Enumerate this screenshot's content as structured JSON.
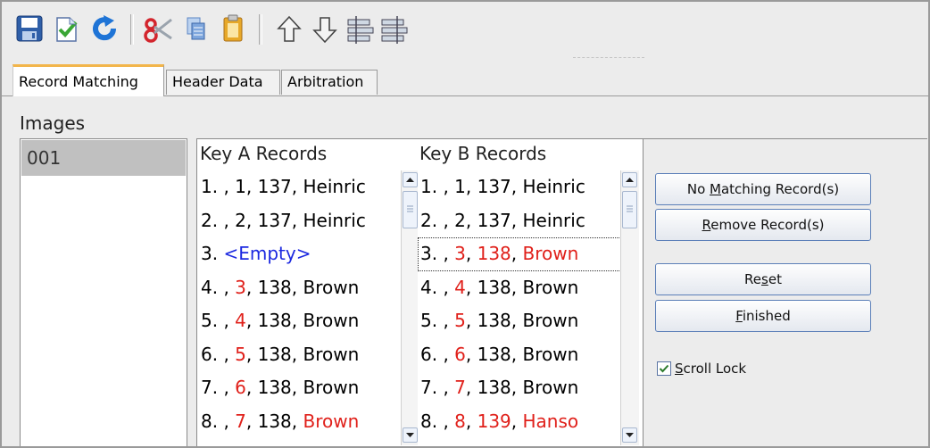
{
  "toolbar": {
    "buttons": [
      {
        "name": "save-icon"
      },
      {
        "name": "edit-document-icon"
      },
      {
        "name": "refresh-icon"
      },
      {
        "name": "cut-icon"
      },
      {
        "name": "copy-icon"
      },
      {
        "name": "paste-icon"
      },
      {
        "name": "move-up-icon"
      },
      {
        "name": "move-down-icon"
      },
      {
        "name": "align-left-icon"
      },
      {
        "name": "align-right-icon"
      }
    ]
  },
  "tabs": [
    {
      "label": "Record Matching",
      "active": true
    },
    {
      "label": "Header Data",
      "active": false
    },
    {
      "label": "Arbitration",
      "active": false
    }
  ],
  "images": {
    "label": "Images",
    "items": [
      "001"
    ],
    "selected": "001"
  },
  "key_a": {
    "header": "Key A Records",
    "rows": [
      [
        {
          "t": "1. , 1, 137, Heinric"
        }
      ],
      [
        {
          "t": "2. , 2, 137, Heinric"
        }
      ],
      [
        {
          "t": "3. "
        },
        {
          "t": "<Empty>",
          "c": "blue"
        }
      ],
      [
        {
          "t": "4. , "
        },
        {
          "t": "3",
          "c": "red"
        },
        {
          "t": ", 138, Brown"
        }
      ],
      [
        {
          "t": "5. , "
        },
        {
          "t": "4",
          "c": "red"
        },
        {
          "t": ", 138, Brown"
        }
      ],
      [
        {
          "t": "6. , "
        },
        {
          "t": "5",
          "c": "red"
        },
        {
          "t": ", 138, Brown"
        }
      ],
      [
        {
          "t": "7. , "
        },
        {
          "t": "6",
          "c": "red"
        },
        {
          "t": ", 138, Brown"
        }
      ],
      [
        {
          "t": "8. , "
        },
        {
          "t": "7",
          "c": "red"
        },
        {
          "t": ", 138, "
        },
        {
          "t": "Brown",
          "c": "red"
        }
      ]
    ]
  },
  "key_b": {
    "header": "Key B Records",
    "focused_row": 2,
    "rows": [
      [
        {
          "t": "1. , 1, 137, Heinric"
        }
      ],
      [
        {
          "t": "2. , 2, 137, Heinric"
        }
      ],
      [
        {
          "t": "3. , "
        },
        {
          "t": "3",
          "c": "red"
        },
        {
          "t": ", "
        },
        {
          "t": "138",
          "c": "red"
        },
        {
          "t": ", "
        },
        {
          "t": "Brown",
          "c": "red"
        }
      ],
      [
        {
          "t": "4. , "
        },
        {
          "t": "4",
          "c": "red"
        },
        {
          "t": ", 138, Brown"
        }
      ],
      [
        {
          "t": "5. , "
        },
        {
          "t": "5",
          "c": "red"
        },
        {
          "t": ", 138, Brown"
        }
      ],
      [
        {
          "t": "6. , "
        },
        {
          "t": "6",
          "c": "red"
        },
        {
          "t": ", 138, Brown"
        }
      ],
      [
        {
          "t": "7. , "
        },
        {
          "t": "7",
          "c": "red"
        },
        {
          "t": ", 138, Brown"
        }
      ],
      [
        {
          "t": "8. , "
        },
        {
          "t": "8",
          "c": "red"
        },
        {
          "t": ", "
        },
        {
          "t": "139",
          "c": "red"
        },
        {
          "t": ", "
        },
        {
          "t": "Hanso",
          "c": "red"
        }
      ]
    ]
  },
  "actions": {
    "no_matching": {
      "pre": "No ",
      "key": "M",
      "post": "atching Record(s)"
    },
    "remove": {
      "pre": "",
      "key": "R",
      "post": "emove Record(s)"
    },
    "reset": {
      "pre": "Re",
      "key": "s",
      "post": "et"
    },
    "finished": {
      "pre": "",
      "key": "F",
      "post": "inished"
    }
  },
  "scroll_lock": {
    "pre": "",
    "key": "S",
    "post": "croll Lock",
    "checked": true
  },
  "colors": {
    "red": "#e0201a",
    "blue": "#1c29e0",
    "tab_accent": "#f2b54a",
    "selection": "#c0c0c0"
  }
}
